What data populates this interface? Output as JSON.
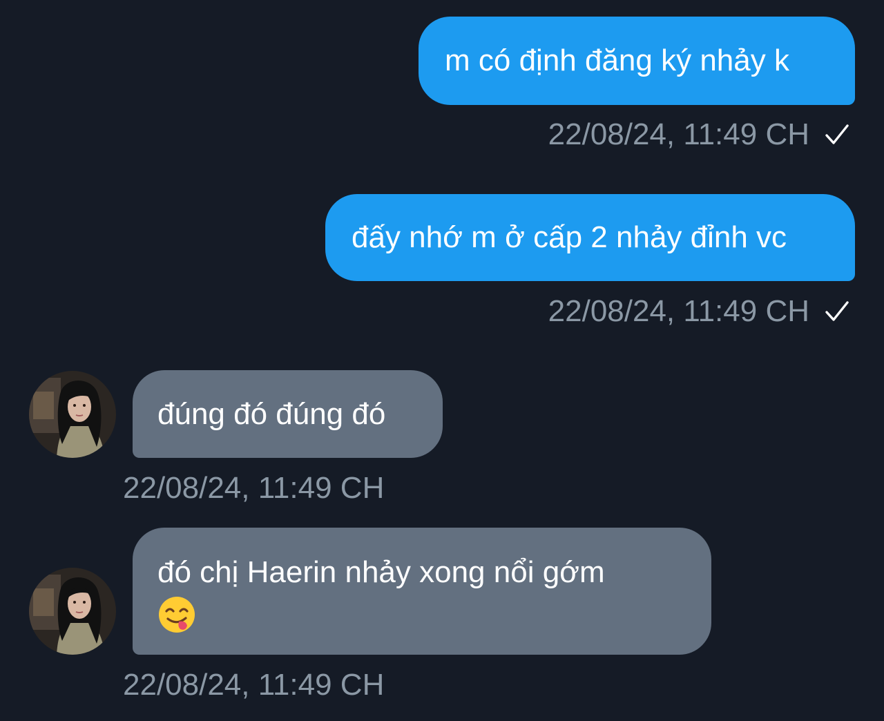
{
  "messages": [
    {
      "direction": "outgoing",
      "text": "m có định đăng ký nhảy k",
      "timestamp": "22/08/24, 11:49 CH",
      "status": "check-icon"
    },
    {
      "direction": "outgoing",
      "text": "đấy nhớ m ở cấp 2 nhảy đỉnh vc",
      "timestamp": "22/08/24, 11:49 CH",
      "status": "check-icon"
    },
    {
      "direction": "incoming",
      "text": "đúng đó đúng đó",
      "timestamp": "22/08/24, 11:49 CH",
      "avatar": "avatar"
    },
    {
      "direction": "incoming",
      "text": "đó chị Haerin nhảy xong nổi gớm",
      "emoji": "savoring-food-emoji",
      "timestamp": "22/08/24, 11:49 CH",
      "avatar": "avatar"
    }
  ],
  "colors": {
    "background": "#151b26",
    "outgoing_bubble": "#1d9bf0",
    "incoming_bubble": "#637080",
    "timestamp": "#8b98a5",
    "text": "#ffffff"
  }
}
